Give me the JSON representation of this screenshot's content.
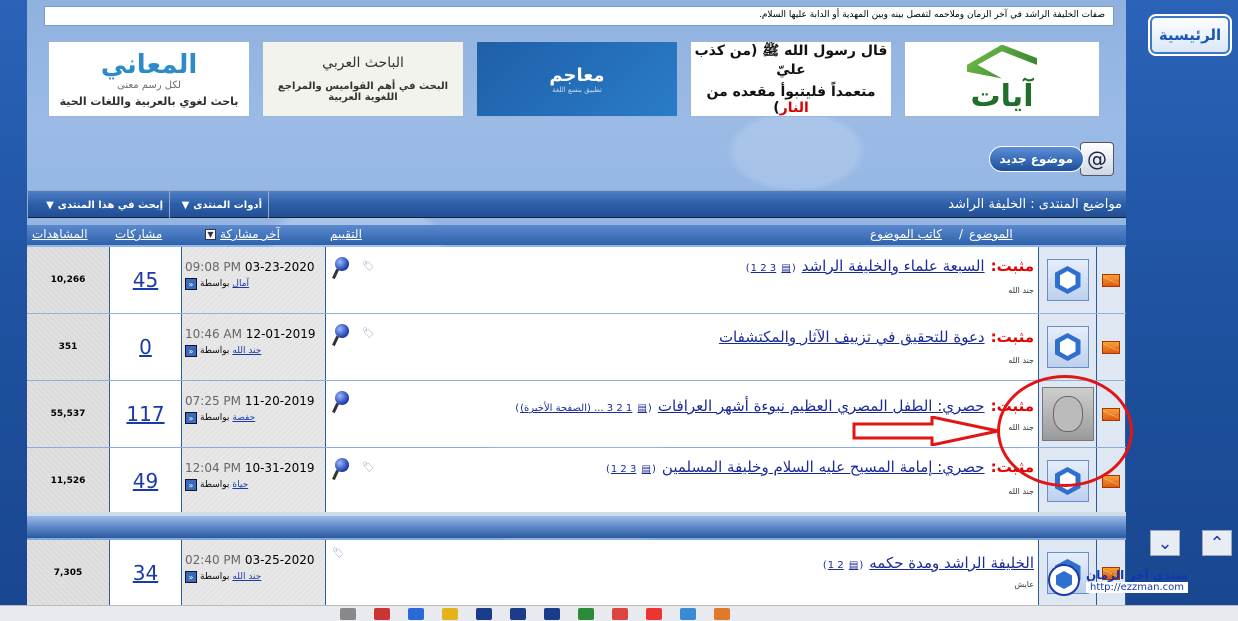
{
  "header": {
    "marquee": "صفات الخليفة الراشد في آخر الزمان وملاحمه لتفصل بينه وبين المهدية أو الدابة عليها السلام.",
    "home_label": "الرئيسية"
  },
  "banners": [
    {
      "line1": "المعاني",
      "line2": "لكل رسم معنى",
      "line3": "باحث لغوي بالعربية واللغات الحية"
    },
    {
      "line1": "الباحث العربي",
      "line2": "البحث في أهم القواميس والمراجع اللغوية العربية"
    },
    {
      "line1": "معاجم",
      "line2": "تطبيق بنسع اللغة"
    },
    {
      "line1": "قال رسول الله ﷺ (من كذب عليّ",
      "line2a": "متعمداً فليتبوأ مقعده من ",
      "line2b": "النار",
      "line2c": ")"
    },
    {
      "line1": "آيات"
    }
  ],
  "new_topic": {
    "label": "موضوع جديد",
    "icon": "envelope-at-icon"
  },
  "forum_bar": {
    "title": "مواضيع المنتدى  :  الخليفة الراشد",
    "tools_label": "أدوات المنتدى",
    "search_label": "إبحث في هذا المنتدى"
  },
  "columns": {
    "topic": "الموضوع",
    "author": "كاتب الموضوع",
    "rating": "التقييم",
    "last_post": "آخر مشاركة",
    "posts": "مشاركات",
    "views": "المشاهدات"
  },
  "rows": [
    {
      "sticky": "مثبت:",
      "title": "السبعة علماء والخليفة الراشد",
      "pages": "3 2 1",
      "author": "جند الله",
      "date": "03-23-2020",
      "time": "09:08 PM",
      "by_prefix": "بواسطة",
      "by": "آمال",
      "posts": "45",
      "views": "10,266"
    },
    {
      "sticky": "مثبت:",
      "title": "دعوة للتحقيق في تزييف الآثار والمكتشفات",
      "pages": "",
      "author": "جند الله",
      "date": "12-01-2019",
      "time": "10:46 AM",
      "by_prefix": "بواسطة",
      "by": "جند الله",
      "posts": "0",
      "views": "351"
    },
    {
      "sticky": "مثبت:",
      "title": "حصري: الطفل المصري العظيم نبوءة أشهر العرافات",
      "pages": "1 2 3 ... (الصفحة الأخيرة)",
      "author": "جند الله",
      "date": "11-20-2019",
      "time": "07:25 PM",
      "by_prefix": "بواسطة",
      "by": "حفصة",
      "posts": "117",
      "views": "55,537"
    },
    {
      "sticky": "مثبت:",
      "title": "حصري: إمامة المسيح عليه السلام وخليفة المسلمين",
      "pages": "3 2 1",
      "author": "جند الله",
      "date": "10-31-2019",
      "time": "12:04 PM",
      "by_prefix": "بواسطة",
      "by": "حياة",
      "posts": "49",
      "views": "11,526"
    },
    {
      "sticky": "",
      "title": "الخليفة الراشد ومدة حكمه",
      "pages": "2 1",
      "author": "عايش",
      "date": "03-25-2020",
      "time": "02:40 PM",
      "by_prefix": "بواسطة",
      "by": "جند الله",
      "posts": "34",
      "views": "7,305"
    }
  ],
  "footer_logo": {
    "name": "منتدى آخر الزمان",
    "url": "http://ezzman.com"
  },
  "colors": {
    "accent": "#1a3aa8",
    "sticky": "#e30000",
    "annotation": "#e21414"
  }
}
